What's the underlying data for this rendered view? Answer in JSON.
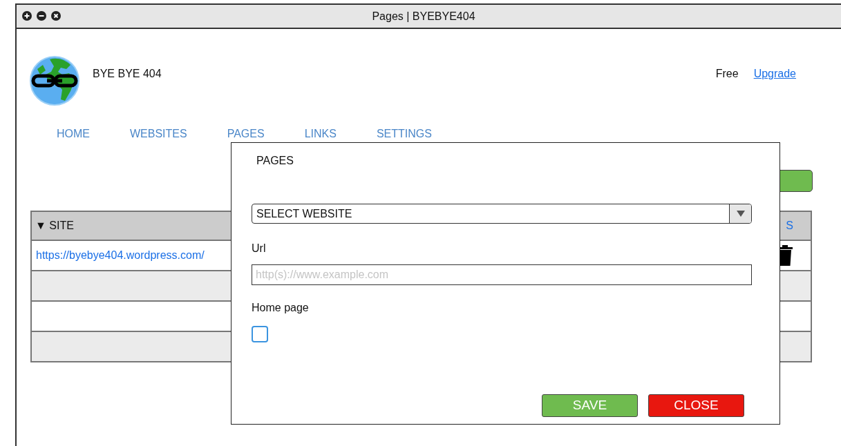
{
  "window": {
    "title": "Pages | BYEBYE404"
  },
  "app": {
    "name": "BYE BYE 404",
    "plan": "Free",
    "upgrade_link": "Upgrade"
  },
  "nav": [
    {
      "label": "HOME"
    },
    {
      "label": "WEBSITES"
    },
    {
      "label": "PAGES"
    },
    {
      "label": "LINKS"
    },
    {
      "label": "SETTINGS"
    }
  ],
  "table": {
    "columns": [
      {
        "label": "SITE",
        "sort": "▼"
      },
      {
        "label": "S"
      }
    ],
    "rows": [
      {
        "kind": "link",
        "site": "https://byebye404.wordpress.com/"
      },
      {
        "kind": "blank"
      },
      {
        "kind": "blank"
      },
      {
        "kind": "blank"
      }
    ]
  },
  "dialog": {
    "title": "PAGES",
    "select": {
      "value": "SELECT WEBSITE"
    },
    "url": {
      "label": "Url",
      "placeholder": "http(s)://www.example.com"
    },
    "home_page": {
      "label": "Home page",
      "checked": false
    },
    "buttons": [
      {
        "kind": "save",
        "label": "SAVE"
      },
      {
        "kind": "close",
        "label": "CLOSE"
      }
    ]
  }
}
